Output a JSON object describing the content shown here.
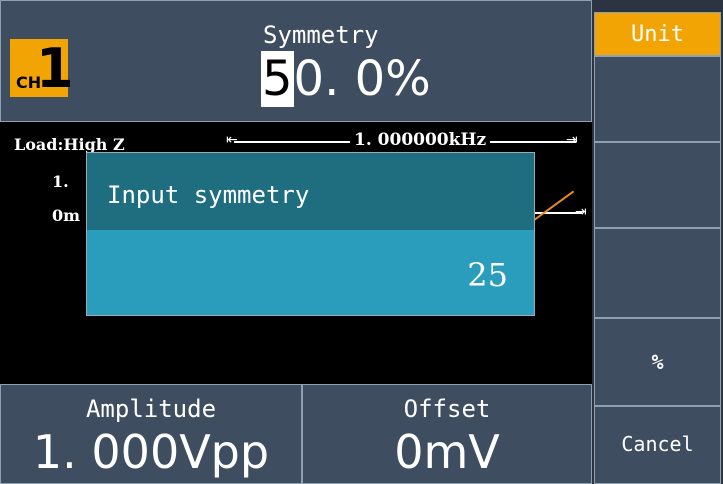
{
  "header": {
    "channel_prefix": "CH",
    "channel_number": "1",
    "param_title": "Symmetry",
    "param_value_cursor": "5",
    "param_value_rest": "0. 0%"
  },
  "display": {
    "load": "Load:High Z",
    "frequency": "1. 000000kHz",
    "side_label_1": "1.",
    "side_label_2": "0m"
  },
  "dialog": {
    "title": "Input symmetry",
    "value": "25"
  },
  "footer": {
    "amplitude_label": "Amplitude",
    "amplitude_value": "1. 000Vpp",
    "offset_label": "Offset",
    "offset_value": "0mV"
  },
  "menu": {
    "items": [
      "Unit",
      "",
      "",
      "",
      "%",
      "Cancel"
    ]
  },
  "colors": {
    "accent": "#f3a405",
    "panel": "#3e4e60",
    "dialog_bg": "#1f6e80",
    "dialog_input": "#2a9cbc",
    "waveform": "#f08a20"
  }
}
